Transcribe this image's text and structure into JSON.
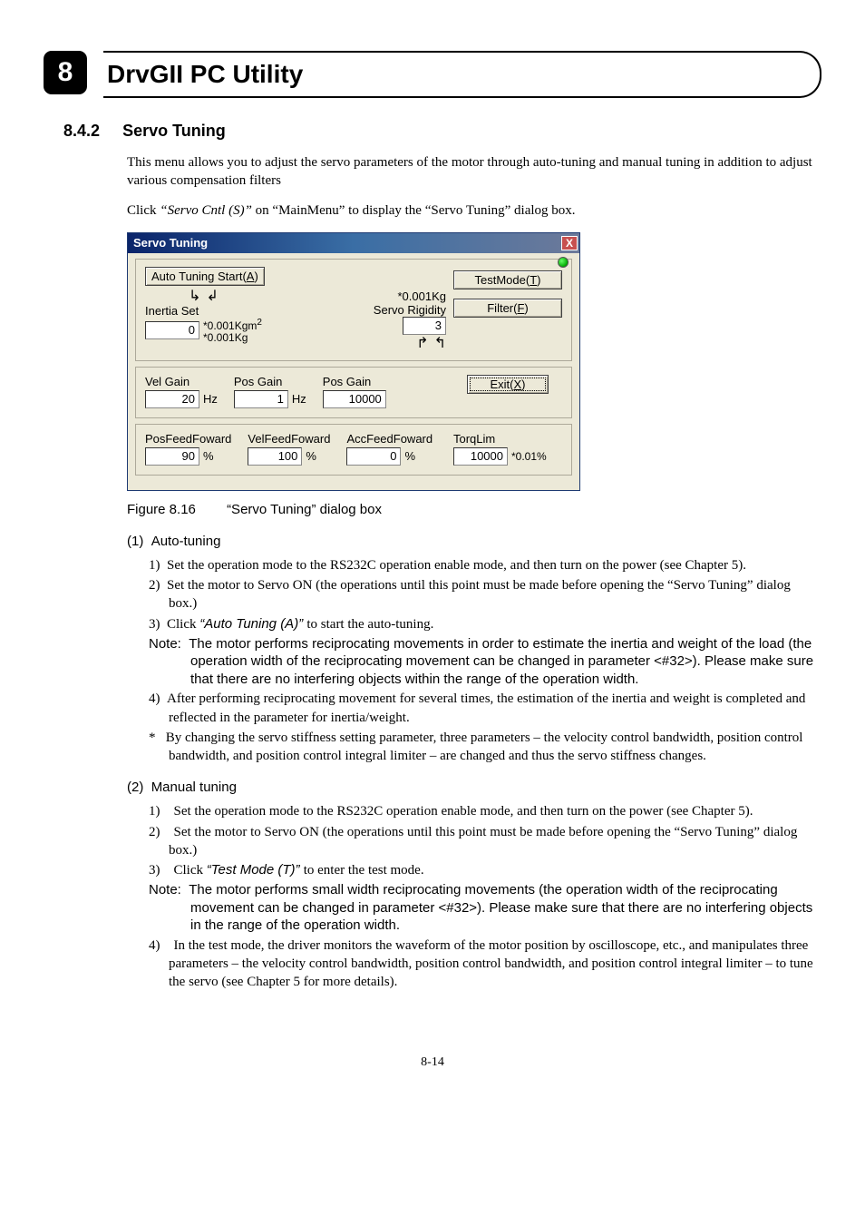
{
  "chapter": {
    "number": "8",
    "title": "DrvGII PC Utility"
  },
  "section": {
    "number": "8.4.2",
    "title": "Servo Tuning"
  },
  "intro": {
    "p1": "This menu allows you to adjust the servo parameters of the motor through auto-tuning and manual tuning in addition to adjust various compensation filters",
    "p2_a": "Click ",
    "p2_q": "“Servo Cntl (S)” ",
    "p2_b": "on “MainMenu” to display the “Servo Tuning” dialog box."
  },
  "dialog": {
    "title": "Servo Tuning",
    "close": "X",
    "auto_tuning_btn_a": "Auto Tuning Start(",
    "auto_tuning_btn_u": "A",
    "auto_tuning_btn_b": ")",
    "testmode_btn_a": "TestMode(",
    "testmode_btn_u": "T",
    "testmode_btn_b": ")",
    "filter_btn_a": "Filter(",
    "filter_btn_u": "F",
    "filter_btn_b": ")",
    "exit_btn_a": "Exit(",
    "exit_btn_u": "X",
    "exit_btn_b": ")",
    "star_unit_kg": "*0.001Kg",
    "inertia_set_label": "Inertia Set",
    "inertia_unit_a": "*0.001Kgm",
    "inertia_unit_sup": "2",
    "inertia_unit_b": "*0.001Kg",
    "inertia_value": "0",
    "servo_rigidity_label": "Servo Rigidity",
    "servo_rigidity_value": "3",
    "vel_gain_label": "Vel Gain",
    "vel_gain_value": "20",
    "vel_gain_unit": "Hz",
    "pos_gain_label": "Pos Gain",
    "pos_gain_value": "1",
    "pos_gain_unit": "Hz",
    "pos_gain2_label": "Pos Gain",
    "pos_gain2_value": "10000",
    "pos_ff_label": "PosFeedFoward",
    "pos_ff_value": "90",
    "pos_ff_unit": "%",
    "vel_ff_label": "VelFeedFoward",
    "vel_ff_value": "100",
    "vel_ff_unit": "%",
    "acc_ff_label": "AccFeedFoward",
    "acc_ff_value": "0",
    "acc_ff_unit": "%",
    "torq_lim_label": "TorqLim",
    "torq_lim_value": "10000",
    "torq_lim_unit": "*0.01%"
  },
  "figure": {
    "num": "Figure 8.16",
    "caption": "“Servo Tuning” dialog box"
  },
  "auto": {
    "heading_num": "(1)",
    "heading_text": "Auto-tuning",
    "s1_n": "1)",
    "s1": "Set the operation mode to the RS232C operation enable mode, and then turn on the power (see Chapter 5).",
    "s2_n": "2)",
    "s2": "Set the motor to Servo ON (the operations until this point must be made before opening the “Servo Tuning” dialog box.)",
    "s3_n": "3)",
    "s3_a": "Click ",
    "s3_q": "“Auto Tuning (A)” ",
    "s3_b": "to start the auto-tuning.",
    "note_label": "Note:",
    "note": "The motor performs reciprocating movements in order to estimate the inertia and weight of the load (the operation width of the reciprocating movement can be changed in parameter <#32>). Please make sure that there are no interfering objects within the range of the operation width.",
    "s4_n": "4)",
    "s4": "After performing reciprocating movement for several times, the estimation of the inertia and weight is completed and reflected in the parameter for inertia/weight.",
    "star_n": "*",
    "star": "By changing the servo stiffness setting parameter, three parameters – the velocity control bandwidth, position control bandwidth, and position control integral limiter – are changed and thus the servo stiffness changes."
  },
  "manual": {
    "heading_num": "(2)",
    "heading_text": "Manual tuning",
    "s1_n": "1)",
    "s1": "Set the operation mode to the RS232C operation enable mode, and then turn on the power (see Chapter 5).",
    "s2_n": "2)",
    "s2": "Set the motor to Servo ON (the operations until this point must be made before opening the “Servo Tuning” dialog box.)",
    "s3_n": "3)",
    "s3_a": "Click ",
    "s3_q": "“Test Mode (T)” ",
    "s3_b": "to enter the test mode.",
    "note_label": "Note:",
    "note": "The motor performs small width reciprocating movements (the operation width of the reciprocating movement can be changed in parameter <#32>). Please make sure that there are no interfering objects in the range of the operation width.",
    "s4_n": "4)",
    "s4": "In the test mode, the driver monitors the waveform of the motor position by oscilloscope, etc., and manipulates three parameters – the velocity control bandwidth, position control bandwidth, and position control integral limiter – to tune the servo (see Chapter 5 for more details)."
  },
  "page_number": "8-14"
}
